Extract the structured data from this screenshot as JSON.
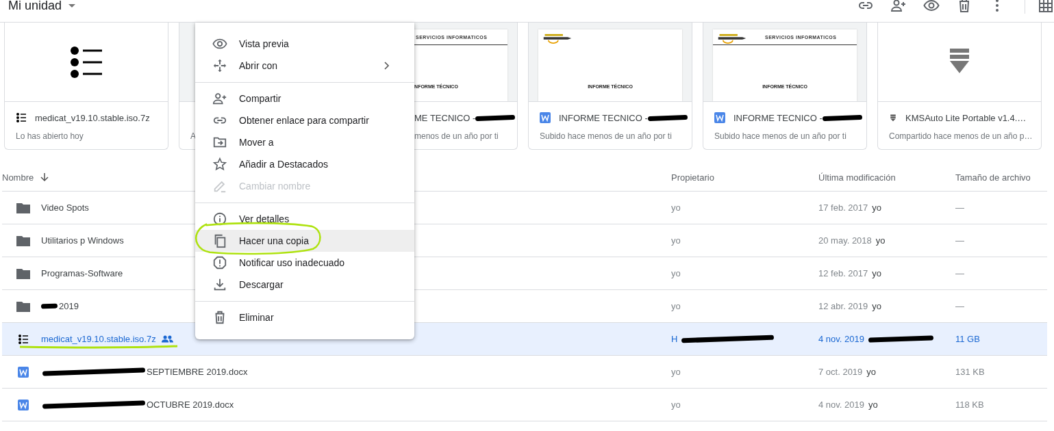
{
  "header": {
    "title": "Mi unidad"
  },
  "cards": [
    {
      "kind": "list-archive",
      "title": "medicat_v19.10.stable.iso.7z",
      "title_redacted": false,
      "subtitle": "Lo has abierto hoy"
    },
    {
      "kind": "covered",
      "subtitle": "A"
    },
    {
      "kind": "document",
      "doc_heading": "SERVICIOS INFORMATICOS",
      "doc_title": "INFORME TÉCNICO",
      "title": "ME TECNICO - ",
      "title_redacted": true,
      "subtitle": "menos de un año por ti"
    },
    {
      "kind": "document",
      "doc_title": "INFORME TÉCNICO",
      "title": "INFORME TECNICO - ",
      "title_redacted": true,
      "subtitle": "Subido hace menos de un año por ti"
    },
    {
      "kind": "document",
      "doc_heading": "SERVICIOS INFORMATICOS",
      "doc_title": "INFORME TÉCNICO",
      "title": "INFORME TECNICO - ",
      "title_redacted": true,
      "subtitle": "Subido hace menos de un año por ti"
    },
    {
      "kind": "archive",
      "title": "KMSAuto Lite Portable v1.4.…",
      "title_redacted": false,
      "subtitle": "Compartido hace menos de un año p…"
    }
  ],
  "table": {
    "columns": [
      "Nombre",
      "Propietario",
      "Última modificación",
      "Tamaño de archivo"
    ],
    "rows": [
      {
        "kind": "folder",
        "name": "Video Spots",
        "name_redacted": false,
        "shared": false,
        "selected": false,
        "owner": "yo",
        "modified": "17 feb. 2017",
        "modified_by": "yo",
        "size": "—"
      },
      {
        "kind": "folder",
        "name": "Utilitarios p Windows",
        "name_redacted": false,
        "shared": false,
        "selected": false,
        "owner": "yo",
        "modified": "20 may. 2018",
        "modified_by": "yo",
        "size": "—"
      },
      {
        "kind": "folder",
        "name": "Programas-Software",
        "name_redacted": false,
        "shared": false,
        "selected": false,
        "owner": "yo",
        "modified": "12 feb. 2017",
        "modified_by": "yo",
        "size": "—"
      },
      {
        "kind": "folder",
        "name": "2019",
        "name_redacted": true,
        "shared": false,
        "selected": false,
        "owner": "yo",
        "modified": "12 abr. 2019",
        "modified_by": "yo",
        "size": "—"
      },
      {
        "kind": "archive",
        "name": "medicat_v19.10.stable.iso.7z",
        "name_redacted": false,
        "shared": true,
        "selected": true,
        "owner": "H",
        "owner_redacted": true,
        "modified": "4 nov. 2019",
        "modified_by_redacted": true,
        "size": "11 GB"
      },
      {
        "kind": "document",
        "name": "SEPTIEMBRE 2019.docx",
        "name_redacted": true,
        "shared": false,
        "selected": false,
        "owner": "yo",
        "modified": "7 oct. 2019",
        "modified_by": "yo",
        "size": "131 KB"
      },
      {
        "kind": "document",
        "name": "OCTUBRE 2019.docx",
        "name_redacted": true,
        "shared": false,
        "selected": false,
        "owner": "yo",
        "modified": "4 nov. 2019",
        "modified_by": "yo",
        "size": "118 KB"
      }
    ]
  },
  "context_menu": [
    {
      "kind": "item",
      "label": "Vista previa",
      "disabled": false,
      "selected": false,
      "submenu": false
    },
    {
      "kind": "item",
      "label": "Abrir con",
      "disabled": false,
      "selected": false,
      "submenu": true
    },
    {
      "kind": "separator"
    },
    {
      "kind": "item",
      "label": "Compartir",
      "disabled": false,
      "selected": false,
      "submenu": false
    },
    {
      "kind": "item",
      "label": "Obtener enlace para compartir",
      "disabled": false,
      "selected": false,
      "submenu": false
    },
    {
      "kind": "item",
      "label": "Mover a",
      "disabled": false,
      "selected": false,
      "submenu": false
    },
    {
      "kind": "item",
      "label": "Añadir a Destacados",
      "disabled": false,
      "selected": false,
      "submenu": false
    },
    {
      "kind": "item",
      "label": "Cambiar nombre",
      "disabled": true,
      "selected": false,
      "submenu": false
    },
    {
      "kind": "separator"
    },
    {
      "kind": "item",
      "label": "Ver detalles",
      "disabled": false,
      "selected": false,
      "submenu": false
    },
    {
      "kind": "item",
      "label": "Hacer una copia",
      "disabled": false,
      "selected": true,
      "submenu": false
    },
    {
      "kind": "item",
      "label": "Notificar uso inadecuado",
      "disabled": false,
      "selected": false,
      "submenu": false
    },
    {
      "kind": "item",
      "label": "Descargar",
      "disabled": false,
      "selected": false,
      "submenu": false
    },
    {
      "kind": "separator"
    },
    {
      "kind": "item",
      "label": "Eliminar",
      "disabled": false,
      "selected": false,
      "submenu": false
    }
  ]
}
